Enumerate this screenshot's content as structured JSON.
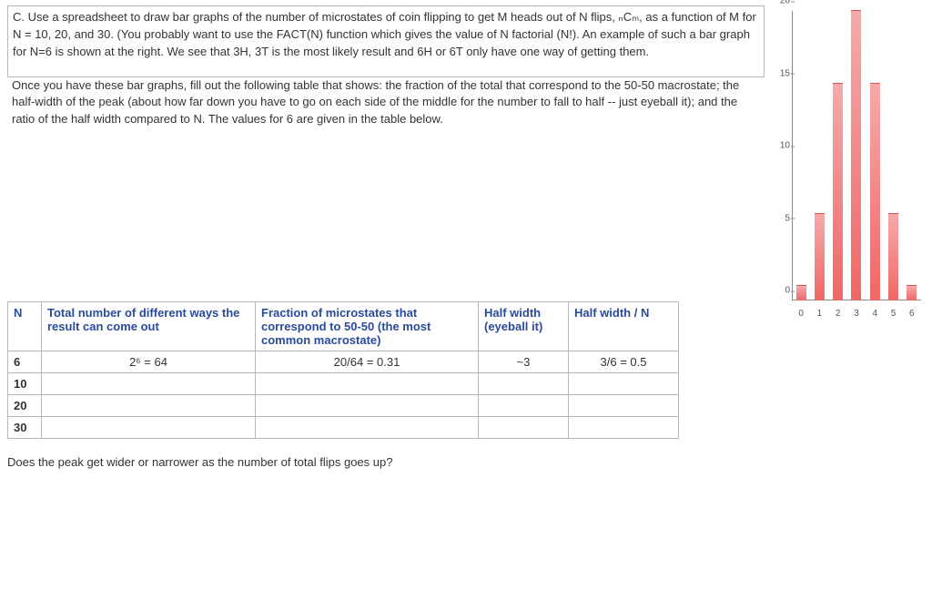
{
  "paragraph1": "C.  Use a spreadsheet to draw bar graphs of the number of microstates of coin flipping to get M heads out of N flips, ₙCₘ, as a function of M for N = 10, 20, and 30. (You probably want to use the FACT(N) function which gives the value of N factorial (N!). An example of such a bar graph for N=6 is shown at the right. We see that 3H, 3T is the most likely result and 6H or 6T only have one way of getting them.",
  "paragraph2": "Once you have these bar graphs, fill out the following table that shows: the fraction of the total that correspond to the 50-50 macrostate; the half-width of the peak (about how far down you have to go on each side of the middle for the number to fall to half -- just eyeball it); and the ratio of the half width compared to N. The values for 6 are given in the table below.",
  "table": {
    "headers": {
      "n": "N",
      "total": "Total number of different ways the result can come out",
      "fraction": "Fraction of microstates that correspond to 50-50 (the most common macrostate)",
      "halfwidth": "Half width (eyeball it)",
      "ratio": "Half width / N"
    },
    "rows": [
      {
        "n": "6",
        "total": "2⁶ = 64",
        "fraction": "20/64 = 0.31",
        "halfwidth": "~3",
        "ratio": "3/6 = 0.5"
      },
      {
        "n": "10",
        "total": "",
        "fraction": "",
        "halfwidth": "",
        "ratio": ""
      },
      {
        "n": "20",
        "total": "",
        "fraction": "",
        "halfwidth": "",
        "ratio": ""
      },
      {
        "n": "30",
        "total": "",
        "fraction": "",
        "halfwidth": "",
        "ratio": ""
      }
    ]
  },
  "question": "Does the peak get wider or narrower as the number of total flips goes up?",
  "chart_data": {
    "type": "bar",
    "title": "",
    "xlabel": "",
    "ylabel": "",
    "categories": [
      "0",
      "1",
      "2",
      "3",
      "4",
      "5",
      "6"
    ],
    "values": [
      1,
      6,
      15,
      20,
      15,
      6,
      1
    ],
    "ylim": [
      0,
      20
    ],
    "yticks": [
      0,
      5,
      10,
      15,
      20
    ]
  }
}
